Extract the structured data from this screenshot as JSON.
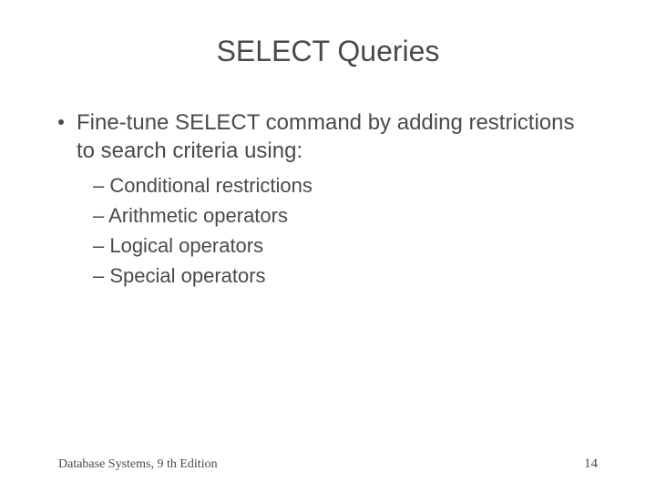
{
  "title": "SELECT Queries",
  "main_bullet": "Fine-tune SELECT command by adding restrictions to search criteria using:",
  "sub_items": {
    "0": "– Conditional restrictions",
    "1": "– Arithmetic operators",
    "2": "– Logical operators",
    "3": "– Special operators"
  },
  "footer": {
    "left": "Database Systems, 9 th Edition",
    "right": "14"
  }
}
